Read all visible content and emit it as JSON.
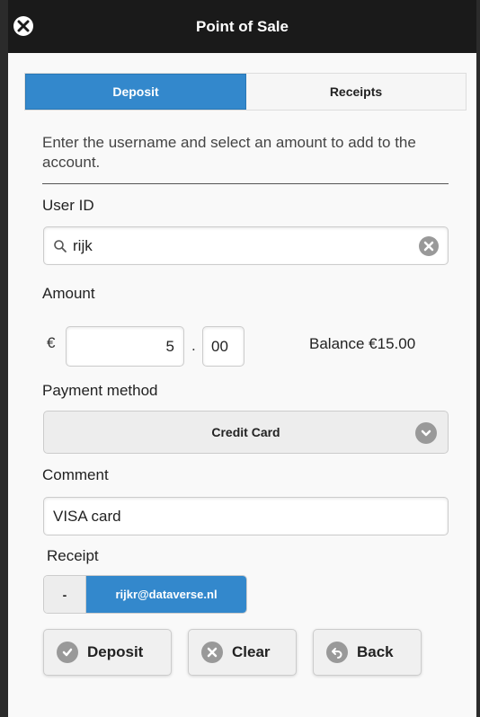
{
  "header": {
    "title": "Point of Sale",
    "close_icon": "close-icon"
  },
  "tabs": [
    {
      "label": "Deposit",
      "active": true
    },
    {
      "label": "Receipts",
      "active": false
    }
  ],
  "intro": "Enter the username and select an amount to add to the account.",
  "user_id": {
    "label": "User ID",
    "value": "rijk"
  },
  "amount": {
    "label": "Amount",
    "currency": "€",
    "major": "5",
    "separator": ".",
    "minor": "00",
    "balance": "Balance €15.00"
  },
  "payment": {
    "label": "Payment method",
    "value": "Credit Card"
  },
  "comment": {
    "label": "Comment",
    "value": "VISA card"
  },
  "receipt": {
    "label": "Receipt",
    "minus": "-",
    "email": "rijkr@dataverse.nl"
  },
  "buttons": {
    "deposit": "Deposit",
    "clear": "Clear",
    "back": "Back"
  },
  "colors": {
    "accent": "#3388cc",
    "topbar": "#1a1a1a"
  }
}
